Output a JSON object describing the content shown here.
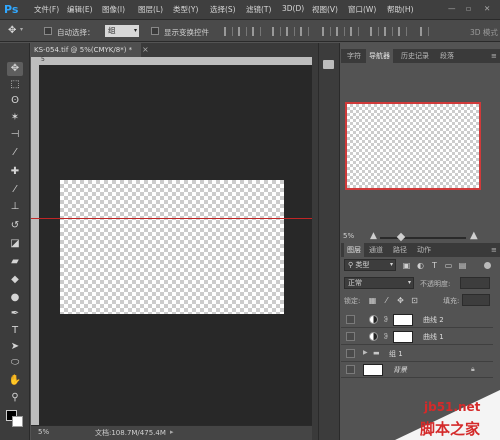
{
  "app": {
    "logo": "Ps"
  },
  "menu": [
    "文件(F)",
    "编辑(E)",
    "图像(I)",
    "图层(L)",
    "类型(Y)",
    "选择(S)",
    "滤镜(T)",
    "3D(D)",
    "视图(V)",
    "窗口(W)",
    "帮助(H)"
  ],
  "options": {
    "auto_select_label": "自动选择：",
    "auto_select_value": "组",
    "transform_controls_label": "显示变换控件",
    "mode_3d_label": "3D 模式"
  },
  "document": {
    "tab_title": "KS-054.tif @ 5%(CMYK/8*) *",
    "zoom": "5%",
    "doc_info": "文档:108.7M/475.4M"
  },
  "ruler": {
    "top_tick": "5"
  },
  "panels": {
    "top_tabs": [
      "字符",
      "导航器",
      "历史记录",
      "段落"
    ],
    "top_active": "导航器",
    "navigator_zoom": "5%",
    "layer_tabs": [
      "图层",
      "通道",
      "路径",
      "动作"
    ],
    "layer_active": "图层",
    "filter_kind": "类型",
    "blend_mode": "正常",
    "opacity_label": "不透明度:",
    "lock_label": "锁定:",
    "fill_label": "填充:"
  },
  "layers": [
    {
      "name": "曲线 2",
      "kind": "adjustment"
    },
    {
      "name": "曲线 1",
      "kind": "adjustment"
    },
    {
      "name": "组 1",
      "kind": "group"
    },
    {
      "name": "背景",
      "kind": "background"
    }
  ],
  "watermark": {
    "line1": "jb51.net",
    "line2": "脚本之家"
  }
}
